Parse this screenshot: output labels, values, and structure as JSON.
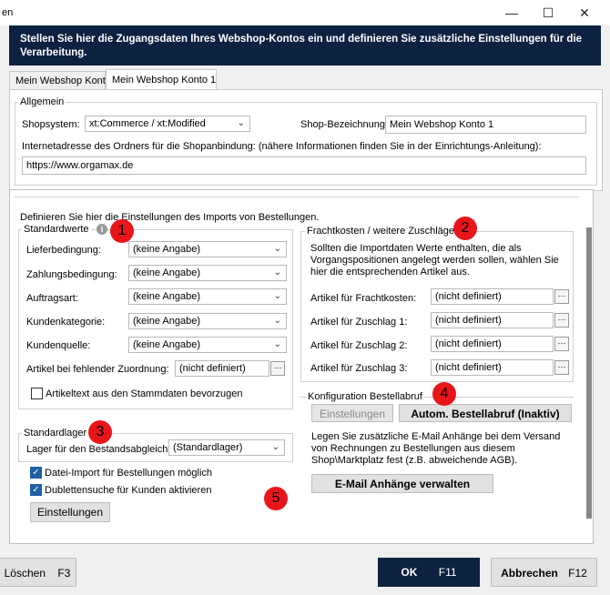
{
  "window": {
    "title": "en",
    "minimize": "—",
    "maximize": "☐",
    "close": "✕"
  },
  "header": {
    "text": "Stellen Sie hier die Zugangsdaten Ihres Webshop-Kontos ein und definieren Sie zusätzliche Einstellungen für die Verarbeitung."
  },
  "tabs": [
    {
      "label": "Mein Webshop Konto"
    },
    {
      "label": "Mein Webshop Konto 1"
    }
  ],
  "allgemein": {
    "title": "Allgemein",
    "shopsystem_label": "Shopsystem:",
    "shopsystem_value": "xt:Commerce / xt:Modified",
    "shop_bezeichnung_label": "Shop-Bezeichnung:",
    "shop_bezeichnung_value": "Mein Webshop Konto 1",
    "url_label": "Internetadresse des Ordners für die Shopanbindung: (nähere Informationen finden Sie in der Einrichtungs-Anleitung):",
    "url_value": "https://www.orgamax.de"
  },
  "import": {
    "intro": "Definieren Sie hier die Einstellungen des Imports von Bestellungen."
  },
  "standardwerte": {
    "title": "Standardwerte",
    "info_icon": "i",
    "rows": [
      {
        "label": "Lieferbedingung:",
        "value": "(keine Angabe)"
      },
      {
        "label": "Zahlungsbedingung:",
        "value": "(keine Angabe)"
      },
      {
        "label": "Auftragsart:",
        "value": "(keine Angabe)"
      },
      {
        "label": "Kundenkategorie:",
        "value": "(keine Angabe)"
      },
      {
        "label": "Kundenquelle:",
        "value": "(keine Angabe)"
      }
    ],
    "artikel_label": "Artikel bei fehlender Zuordnung:",
    "artikel_value": "(nicht definiert)",
    "artikeltext_label": "Artikeltext aus den Stammdaten bevorzugen",
    "artikeltext_checked": false
  },
  "standardlager": {
    "title": "Standardlager",
    "label": "Lager für den Bestandsabgleich:",
    "value": "(Standardlager)"
  },
  "options": {
    "datei_import_label": "Datei-Import für Bestellungen möglich",
    "datei_import_checked": true,
    "dubletten_label": "Dublettensuche für Kunden aktivieren",
    "dubletten_checked": true,
    "einstellungen_button": "Einstellungen"
  },
  "fracht": {
    "title": "Frachtkosten / weitere Zuschläge",
    "description": "Sollten die Importdaten Werte enthalten, die als Vorgangspositionen angelegt werden sollen, wählen Sie hier die entsprechenden Artikel aus.",
    "rows": [
      {
        "label": "Artikel für Frachtkosten:",
        "value": "(nicht definiert)"
      },
      {
        "label": "Artikel für Zuschlag 1:",
        "value": "(nicht definiert)"
      },
      {
        "label": "Artikel für Zuschlag 2:",
        "value": "(nicht definiert)"
      },
      {
        "label": "Artikel für Zuschlag 3:",
        "value": "(nicht definiert)"
      }
    ]
  },
  "bestellabruf": {
    "title": "Konfiguration Bestellabruf",
    "einstellungen_button": "Einstellungen",
    "autom_button": "Autom. Bestellabruf (Inaktiv)"
  },
  "email": {
    "description": "Legen Sie zusätzliche E-Mail Anhänge bei dem Versand von Rechnungen zu Bestellungen aus diesem Shop\\Marktplatz fest (z.B. abweichende AGB).",
    "button": "E-Mail Anhänge verwalten"
  },
  "markers": [
    "1",
    "2",
    "3",
    "4",
    "5"
  ],
  "footer": {
    "delete_label": "Löschen",
    "delete_key": "F3",
    "ok_label": "OK",
    "ok_key": "F11",
    "cancel_label": "Abbrechen",
    "cancel_key": "F12"
  },
  "colors": {
    "header_bg": "#0d2240",
    "ok_bg": "#0d2240",
    "marker_red": "#e8151b",
    "checkbox_blue": "#1f5fa8"
  }
}
